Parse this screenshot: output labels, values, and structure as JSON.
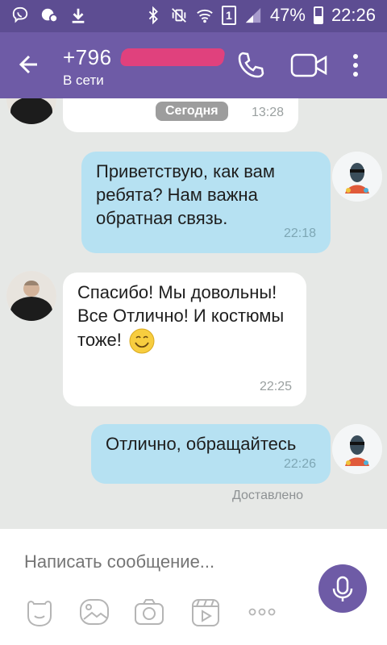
{
  "status_bar": {
    "battery": "47%",
    "time": "22:26",
    "sim": "1"
  },
  "header": {
    "contact_name": "+796",
    "contact_status": "В сети"
  },
  "messages": [
    {
      "sender": "in",
      "time": "13:28",
      "date_label": "Сегодня"
    },
    {
      "sender": "out",
      "text": "Приветствую,  как вам ребята? Нам важна обратная связь.",
      "time": "22:18"
    },
    {
      "sender": "in",
      "text": "Спасибо! Мы довольны! Все Отлично! И костюмы тоже!",
      "time": "22:25",
      "emoji": "smile-emoji"
    },
    {
      "sender": "out",
      "text": "Отлично, обращайтесь",
      "time": "22:26"
    }
  ],
  "delivered_label": "Доставлено",
  "compose": {
    "placeholder": "Написать сообщение..."
  },
  "colors": {
    "header": "#6e5ba6",
    "status_bar": "#5d4d92",
    "outgoing_bubble": "#b6e1f2",
    "incoming_bubble": "#ffffff",
    "chat_bg": "#e6e8e6",
    "redaction": "#e0417d"
  }
}
